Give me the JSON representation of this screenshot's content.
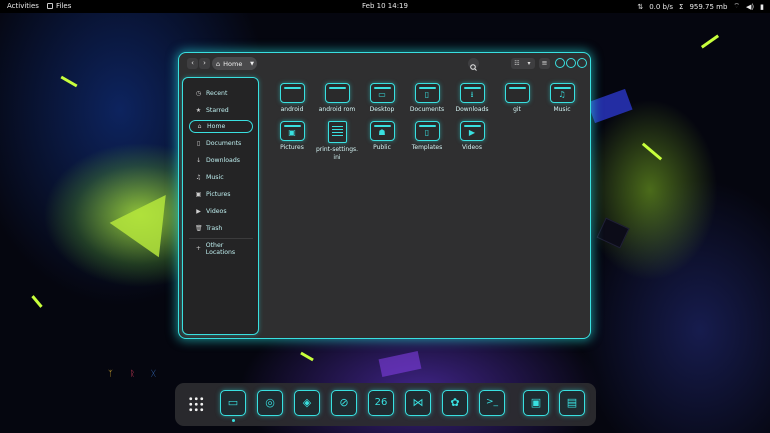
{
  "topbar": {
    "activities": "Activities",
    "app_name": "Files",
    "clock": "Feb 10  14:19",
    "net_speed": "0.0 b/s",
    "sigma": "Σ",
    "memory": "959.75 mb"
  },
  "window": {
    "path_label": "Home",
    "sidebar": [
      {
        "icon": "◷",
        "label": "Recent"
      },
      {
        "icon": "★",
        "label": "Starred"
      },
      {
        "icon": "⌂",
        "label": "Home"
      },
      {
        "icon": "▯",
        "label": "Documents"
      },
      {
        "icon": "↓",
        "label": "Downloads"
      },
      {
        "icon": "♫",
        "label": "Music"
      },
      {
        "icon": "▣",
        "label": "Pictures"
      },
      {
        "icon": "▶",
        "label": "Videos"
      },
      {
        "icon": "🗑",
        "label": "Trash"
      },
      {
        "icon": "+",
        "label": "Other Locations"
      }
    ],
    "files": [
      {
        "label": "android",
        "glyph": ""
      },
      {
        "label": "android rom",
        "glyph": ""
      },
      {
        "label": "Desktop",
        "glyph": "▭"
      },
      {
        "label": "Documents",
        "glyph": "▯"
      },
      {
        "label": "Downloads",
        "glyph": "⭳"
      },
      {
        "label": "git",
        "glyph": ""
      },
      {
        "label": "Music",
        "glyph": "♫"
      },
      {
        "label": "Pictures",
        "glyph": "▣"
      },
      {
        "label": "print-settings.\nini",
        "glyph": ""
      },
      {
        "label": "Public",
        "glyph": "☗"
      },
      {
        "label": "Templates",
        "glyph": "▯"
      },
      {
        "label": "Videos",
        "glyph": "▶"
      }
    ]
  },
  "dock": {
    "items": [
      {
        "glyph": "▭"
      },
      {
        "glyph": "◎"
      },
      {
        "glyph": "◈"
      },
      {
        "glyph": "⊘"
      },
      {
        "glyph": "26"
      },
      {
        "glyph": "⋈"
      },
      {
        "glyph": "✿"
      },
      {
        "glyph": ">_"
      },
      {
        "glyph": "▣"
      },
      {
        "glyph": "▤"
      }
    ]
  },
  "desktop_decor": [
    "ᛉ",
    "ᚱ",
    "ᚷ"
  ],
  "accent_color": "#39e0e0"
}
